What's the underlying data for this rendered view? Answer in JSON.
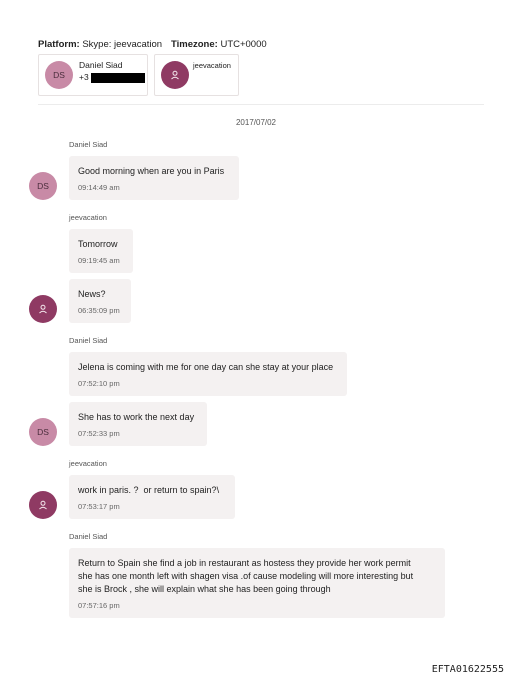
{
  "header": {
    "platform_label": "Platform:",
    "platform_value": "Skype: jeevacation",
    "timezone_label": "Timezone:",
    "timezone_value": "UTC+0000"
  },
  "participants": [
    {
      "initials": "DS",
      "name": "Daniel Siad",
      "phone": "+3"
    },
    {
      "name": "jeevacation",
      "icon": "person-icon"
    }
  ],
  "date": "2017/07/02",
  "messages": [
    {
      "sender": "Daniel Siad",
      "text": "Good morning when are you in Paris",
      "time": "09:14:49 am"
    },
    {
      "sender": "jeevacation",
      "text": "Tomorrow",
      "time": "09:19:45 am"
    },
    {
      "text": "News?",
      "time": "06:35:09 pm"
    },
    {
      "sender": "Daniel Siad",
      "text": "Jelena is coming with me for one day can she stay at your place",
      "time": "07:52:10 pm"
    },
    {
      "text": "She has to work the next day",
      "time": "07:52:33 pm"
    },
    {
      "sender": "jeevacation",
      "text": "work in paris. ?  or return to spain?\\",
      "time": "07:53:17 pm"
    },
    {
      "sender": "Daniel Siad",
      "text": "Return to Spain she find a job in restaurant as hostess they provide her work permit\nshe has one month left with shagen visa .of cause modeling will more interesting but\nshe is Brock , she will explain what she has been going through",
      "time": "07:57:16 pm"
    }
  ],
  "footer_id": "EFTA01622555",
  "colors": {
    "ds_avatar": "#c88aa6",
    "jv_avatar": "#8f3a63",
    "bubble": "#f4f1f1"
  }
}
